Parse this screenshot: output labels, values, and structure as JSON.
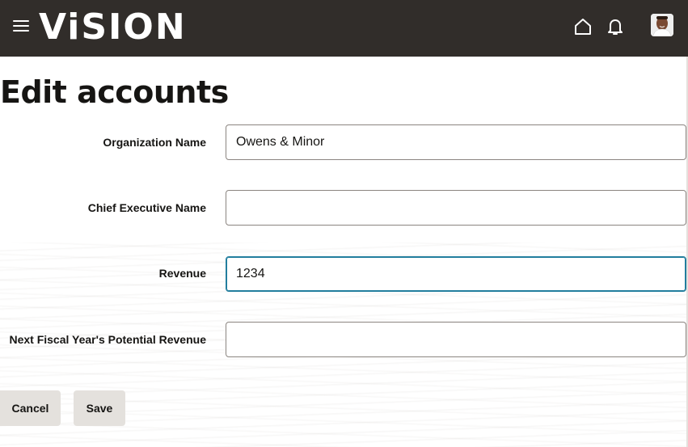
{
  "header": {
    "logo_text": "ViSION",
    "icons": [
      "hamburger-menu-icon",
      "home-icon",
      "bell-icon"
    ],
    "avatar": "user-avatar",
    "background_color": "#312d2a"
  },
  "page": {
    "title": "Edit accounts"
  },
  "form": {
    "fields": [
      {
        "label": "Organization Name",
        "value": "Owens & Minor"
      },
      {
        "label": "Chief Executive Name",
        "value": ""
      },
      {
        "label": "Revenue",
        "value": "1234"
      },
      {
        "label": "Next Fiscal Year's Potential Revenue",
        "value": ""
      }
    ],
    "focused_field": "Revenue",
    "focus_color": "#227e9e"
  },
  "actions": {
    "cancel_label": "Cancel",
    "save_label": "Save"
  }
}
